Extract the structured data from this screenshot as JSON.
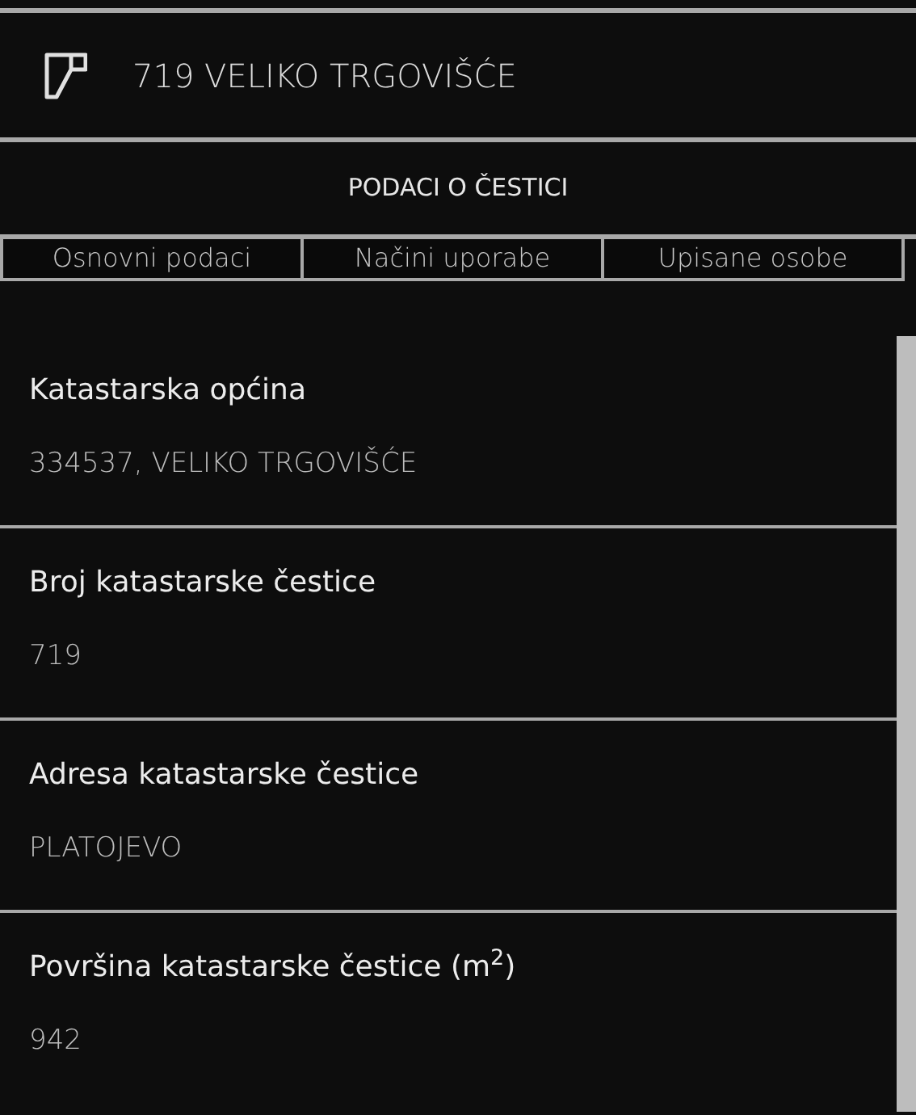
{
  "header": {
    "title": "719 VELIKO TRGOVIŠĆE"
  },
  "section_title": "PODACI O ČESTICI",
  "tabs": [
    {
      "label": "Osnovni podaci"
    },
    {
      "label": "Načini uporabe"
    },
    {
      "label": "Upisane osobe"
    }
  ],
  "fields": [
    {
      "label": "Katastarska općina",
      "value": "334537, VELIKO TRGOVIŠĆE"
    },
    {
      "label": "Broj katastarske čestice",
      "value": "719"
    },
    {
      "label": "Adresa katastarske čestice",
      "value": "PLATOJEVO"
    },
    {
      "label": "Površina katastarske čestice (m$^{2}$)",
      "value": "942"
    }
  ]
}
